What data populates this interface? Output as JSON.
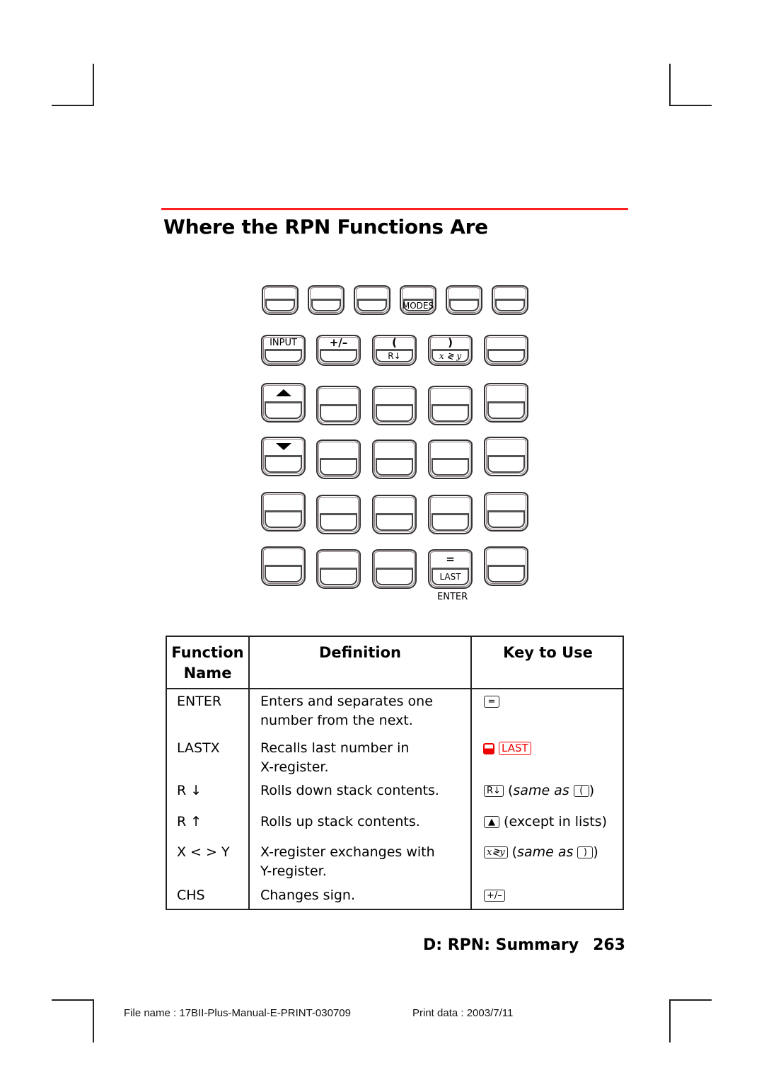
{
  "section": {
    "title": "Where the RPN Functions Are",
    "accent_color": "#ff2020"
  },
  "keypad": {
    "rows": [
      [
        {
          "top": "",
          "bottom": ""
        },
        {
          "top": "",
          "bottom": ""
        },
        {
          "top": "",
          "bottom": ""
        },
        {
          "top": "",
          "bottom": "MODES"
        },
        {
          "top": "",
          "bottom": ""
        },
        {
          "top": "",
          "bottom": ""
        }
      ],
      [
        {
          "top": "INPUT",
          "bottom": ""
        },
        {
          "top": "+/–",
          "bottom": ""
        },
        {
          "top": "(",
          "bottom": "R↓"
        },
        {
          "top": ")",
          "bottom": "x ≷ y"
        },
        {
          "top": "",
          "bottom": ""
        }
      ],
      [
        {
          "top": "up-arrow-icon",
          "bottom": ""
        },
        {
          "top": "",
          "bottom": ""
        },
        {
          "top": "",
          "bottom": ""
        },
        {
          "top": "",
          "bottom": ""
        },
        {
          "top": "",
          "bottom": ""
        }
      ],
      [
        {
          "top": "down-arrow-icon",
          "bottom": ""
        },
        {
          "top": "",
          "bottom": ""
        },
        {
          "top": "",
          "bottom": ""
        },
        {
          "top": "",
          "bottom": ""
        },
        {
          "top": "",
          "bottom": ""
        }
      ],
      [
        {
          "top": "",
          "bottom": ""
        },
        {
          "top": "",
          "bottom": ""
        },
        {
          "top": "",
          "bottom": ""
        },
        {
          "top": "",
          "bottom": ""
        },
        {
          "top": "",
          "bottom": ""
        }
      ],
      [
        {
          "top": "",
          "bottom": ""
        },
        {
          "top": "",
          "bottom": ""
        },
        {
          "top": "",
          "bottom": ""
        },
        {
          "top": "=",
          "bottom": "LAST"
        },
        {
          "top": "",
          "bottom": ""
        }
      ]
    ],
    "enter_label": "ENTER"
  },
  "table": {
    "headers": {
      "name": "Function Name",
      "name_line1": "Function",
      "name_line2": "Name",
      "definition": "Definition",
      "key": "Key to Use"
    },
    "rows": [
      {
        "name": "ENTER",
        "definition_line1": "Enters and separates one",
        "definition_line2": "number from the next.",
        "key": "=",
        "key_note": ""
      },
      {
        "name": "LASTX",
        "definition_line1": "Recalls last number in",
        "definition_line2": "X-register.",
        "key": "LAST",
        "key_shift_color": "#e00000",
        "key_note": ""
      },
      {
        "name": "R ↓",
        "definition_line1": "Rolls down stack contents.",
        "definition_line2": "",
        "key": "R↓",
        "key_note_prefix": "(",
        "key_note": "same as",
        "key_alt": "(",
        "key_note_suffix": ")"
      },
      {
        "name": "R ↑",
        "definition_line1": "Rolls up stack contents.",
        "definition_line2": "",
        "key": "▲",
        "key_note": "(except in lists)"
      },
      {
        "name": "X < > Y",
        "definition_line1": "X-register exchanges with",
        "definition_line2": "Y-register.",
        "key": "x≷y",
        "key_note_prefix": "(",
        "key_note": "same as",
        "key_alt": ")",
        "key_note_suffix": ")"
      },
      {
        "name": "CHS",
        "definition_line1": "Changes sign.",
        "definition_line2": "",
        "key": "+/–",
        "key_note": ""
      }
    ]
  },
  "footer": {
    "chapter": "D: RPN: Summary",
    "page_number": "263",
    "file_name": "File name : 17BII-Plus-Manual-E-PRINT-030709",
    "print_data": "Print data : 2003/7/11"
  }
}
